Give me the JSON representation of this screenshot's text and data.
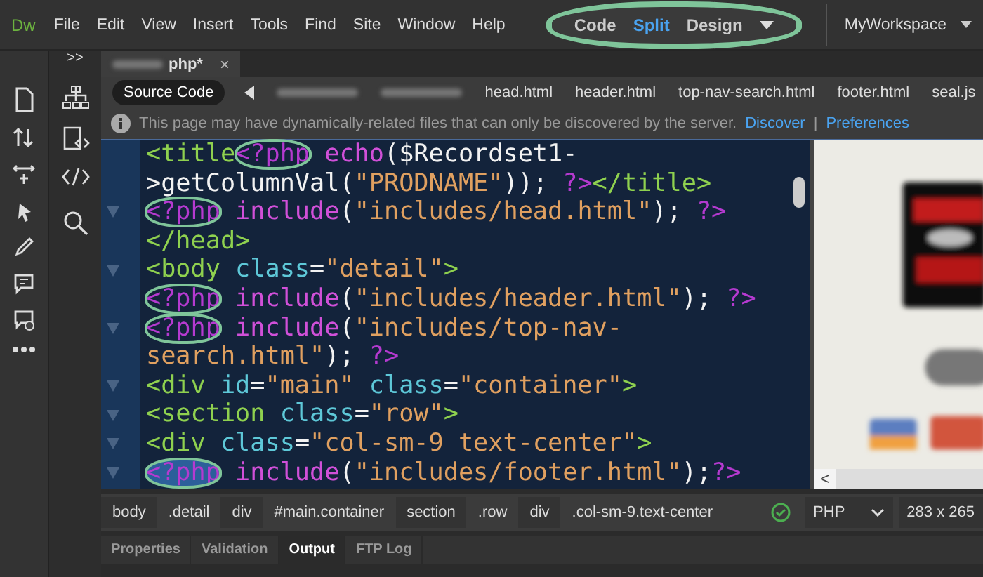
{
  "app": {
    "logo": "Dw"
  },
  "menu": [
    "File",
    "Edit",
    "View",
    "Insert",
    "Tools",
    "Find",
    "Site",
    "Window",
    "Help"
  ],
  "views": {
    "circled": true,
    "items": [
      {
        "label": "Code",
        "selected": false
      },
      {
        "label": "Split",
        "selected": true
      },
      {
        "label": "Design",
        "selected": false
      }
    ]
  },
  "workspace": "MyWorkspace",
  "side_panel": {
    "collapse": ">>"
  },
  "document_tab": {
    "label": "php*",
    "close": "×"
  },
  "related_files": [
    {
      "kind": "source",
      "label": "Source Code",
      "selected": true
    },
    {
      "kind": "blurred"
    },
    {
      "kind": "blurred"
    },
    {
      "kind": "file",
      "label": "head.html"
    },
    {
      "kind": "file",
      "label": "header.html"
    },
    {
      "kind": "file",
      "label": "top-nav-search.html"
    },
    {
      "kind": "file",
      "label": "footer.html"
    },
    {
      "kind": "file",
      "label": "seal.js"
    }
  ],
  "info": {
    "message": "This page may have dynamically-related files that can only be discovered by the server.",
    "links": [
      "Discover",
      "Preferences"
    ],
    "separator": "|"
  },
  "code_lines": [
    {
      "fold": false,
      "tokens": [
        {
          "t": "<title",
          "kind": "tag"
        },
        {
          "t": "<?php",
          "kind": "php",
          "circled": true
        },
        {
          "t": " echo",
          "kind": "fn"
        },
        {
          "t": "($Recordset1-",
          "kind": "plain"
        }
      ]
    },
    {
      "fold": false,
      "tokens": [
        {
          "t": ">getColumnVal(",
          "kind": "plain"
        },
        {
          "t": "\"PRODNAME\"",
          "kind": "str"
        },
        {
          "t": ")); ",
          "kind": "plain"
        },
        {
          "t": "?>",
          "kind": "php"
        },
        {
          "t": "</title>",
          "kind": "tag"
        }
      ]
    },
    {
      "fold": true,
      "tokens": [
        {
          "t": "<?php",
          "kind": "php",
          "circled": true
        },
        {
          "t": " include",
          "kind": "fn"
        },
        {
          "t": "(",
          "kind": "plain"
        },
        {
          "t": "\"includes/head.html\"",
          "kind": "str"
        },
        {
          "t": "); ",
          "kind": "plain"
        },
        {
          "t": "?>",
          "kind": "php"
        }
      ]
    },
    {
      "fold": false,
      "tokens": [
        {
          "t": "</head>",
          "kind": "tag"
        }
      ]
    },
    {
      "fold": true,
      "tokens": [
        {
          "t": "<body",
          "kind": "tag"
        },
        {
          "t": " class",
          "kind": "attr"
        },
        {
          "t": "=",
          "kind": "plain"
        },
        {
          "t": "\"detail\"",
          "kind": "str"
        },
        {
          "t": ">",
          "kind": "tag"
        }
      ]
    },
    {
      "fold": false,
      "tokens": [
        {
          "t": "<?php",
          "kind": "php",
          "circled": true
        },
        {
          "t": " include",
          "kind": "fn"
        },
        {
          "t": "(",
          "kind": "plain"
        },
        {
          "t": "\"includes/header.html\"",
          "kind": "str"
        },
        {
          "t": "); ",
          "kind": "plain"
        },
        {
          "t": "?>",
          "kind": "php"
        }
      ]
    },
    {
      "fold": true,
      "tokens": [
        {
          "t": "<?php",
          "kind": "php",
          "circled": true
        },
        {
          "t": " include",
          "kind": "fn"
        },
        {
          "t": "(",
          "kind": "plain"
        },
        {
          "t": "\"includes/top-nav-",
          "kind": "str"
        }
      ]
    },
    {
      "fold": false,
      "tokens": [
        {
          "t": "search.html\"",
          "kind": "str"
        },
        {
          "t": "); ",
          "kind": "plain"
        },
        {
          "t": "?>",
          "kind": "php"
        }
      ]
    },
    {
      "fold": true,
      "tokens": [
        {
          "t": "<div",
          "kind": "tag"
        },
        {
          "t": " id",
          "kind": "attr"
        },
        {
          "t": "=",
          "kind": "plain"
        },
        {
          "t": "\"main\"",
          "kind": "str"
        },
        {
          "t": " class",
          "kind": "attr"
        },
        {
          "t": "=",
          "kind": "plain"
        },
        {
          "t": "\"container\"",
          "kind": "str"
        },
        {
          "t": ">",
          "kind": "tag"
        }
      ]
    },
    {
      "fold": true,
      "tokens": [
        {
          "t": "<section",
          "kind": "tag"
        },
        {
          "t": " class",
          "kind": "attr"
        },
        {
          "t": "=",
          "kind": "plain"
        },
        {
          "t": "\"row\"",
          "kind": "str"
        },
        {
          "t": ">",
          "kind": "tag"
        }
      ]
    },
    {
      "fold": true,
      "tokens": [
        {
          "t": "<div",
          "kind": "tag"
        },
        {
          "t": " class",
          "kind": "attr"
        },
        {
          "t": "=",
          "kind": "plain"
        },
        {
          "t": "\"col-sm-9 text-center\"",
          "kind": "str"
        },
        {
          "t": ">",
          "kind": "tag"
        }
      ]
    },
    {
      "fold": true,
      "tokens": [
        {
          "t": "<?php",
          "kind": "php",
          "circled": true,
          "highlighted": true
        },
        {
          "t": " include",
          "kind": "fn"
        },
        {
          "t": "(",
          "kind": "plain"
        },
        {
          "t": "\"includes/footer.html\"",
          "kind": "str"
        },
        {
          "t": ");",
          "kind": "plain"
        },
        {
          "t": "?>",
          "kind": "php"
        }
      ]
    }
  ],
  "design_view": {
    "kind": "picture",
    "scroll_left": "<"
  },
  "status_bar": {
    "breadcrumbs": [
      "body",
      ".detail",
      "div",
      "#main.container",
      "section",
      ".row",
      "div",
      ".col-sm-9.text-center"
    ],
    "valid": true,
    "language": "PHP",
    "size": "283 x 265"
  },
  "panel_tabs": [
    {
      "label": "Properties",
      "selected": false
    },
    {
      "label": "Validation",
      "selected": false
    },
    {
      "label": "Output",
      "selected": true
    },
    {
      "label": "FTP Log",
      "selected": false
    }
  ]
}
